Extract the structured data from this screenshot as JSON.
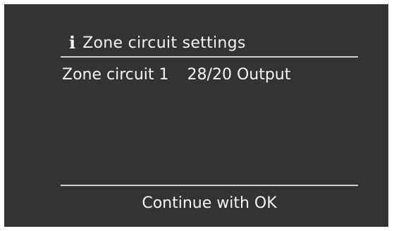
{
  "screen": {
    "header": {
      "icon": "info-icon",
      "icon_glyph": "i",
      "title": "Zone circuit settings"
    },
    "row": {
      "label": "Zone circuit 1",
      "value": "28/20 Output"
    },
    "footer": {
      "hint": "Continue with OK"
    }
  }
}
